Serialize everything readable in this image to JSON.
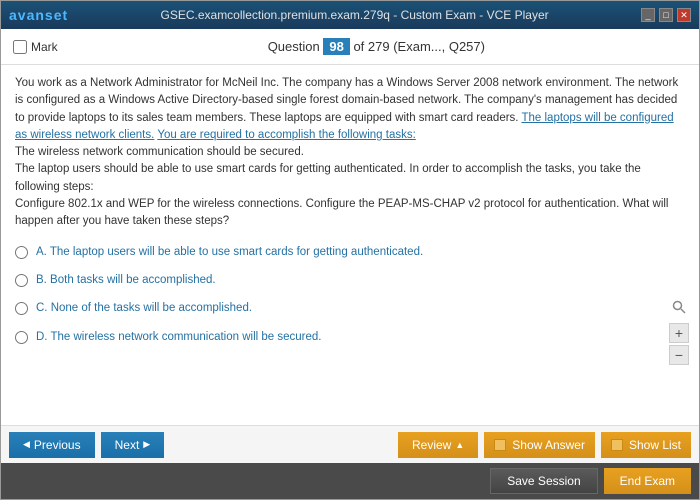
{
  "titlebar": {
    "logo_prefix": "avan",
    "logo_suffix": "set",
    "title": "GSEC.examcollection.premium.exam.279q - Custom Exam - VCE Player",
    "controls": [
      "_",
      "□",
      "✕"
    ]
  },
  "header": {
    "mark_label": "Mark",
    "question_label": "Question",
    "question_number": "98",
    "of_total": "of 279 (Exam..., Q257)"
  },
  "question": {
    "text": "You work as a Network Administrator for McNeil Inc. The company has a Windows Server 2008 network environment. The network is configured as a Windows Active Directory-based single forest domain-based network. The company's management has decided to provide laptops to its sales team members. These laptops are equipped with smart card readers. The laptops will be configured as wireless network clients. You are required to accomplish the following tasks:\nThe wireless network communication should be secured.\nThe laptop users should be able to use smart cards for getting authenticated. In order to accomplish the tasks, you take the following steps:\nConfigure 802.1x and WEP for the wireless connections. Configure the PEAP-MS-CHAP v2 protocol for authentication. What will happen after you have taken these steps?",
    "options": [
      {
        "id": "A",
        "text": "A.  The laptop users will be able to use smart cards for getting authenticated."
      },
      {
        "id": "B",
        "text": "B.  Both tasks will be accomplished."
      },
      {
        "id": "C",
        "text": "C.  None of the tasks will be accomplished."
      },
      {
        "id": "D",
        "text": "D.  The wireless network communication will be secured."
      }
    ]
  },
  "buttons": {
    "previous": "Previous",
    "next": "Next",
    "review": "Review",
    "show_answer": "Show Answer",
    "show_list": "Show List",
    "save_session": "Save Session",
    "end_exam": "End Exam"
  },
  "zoom": {
    "plus": "+",
    "minus": "−"
  }
}
